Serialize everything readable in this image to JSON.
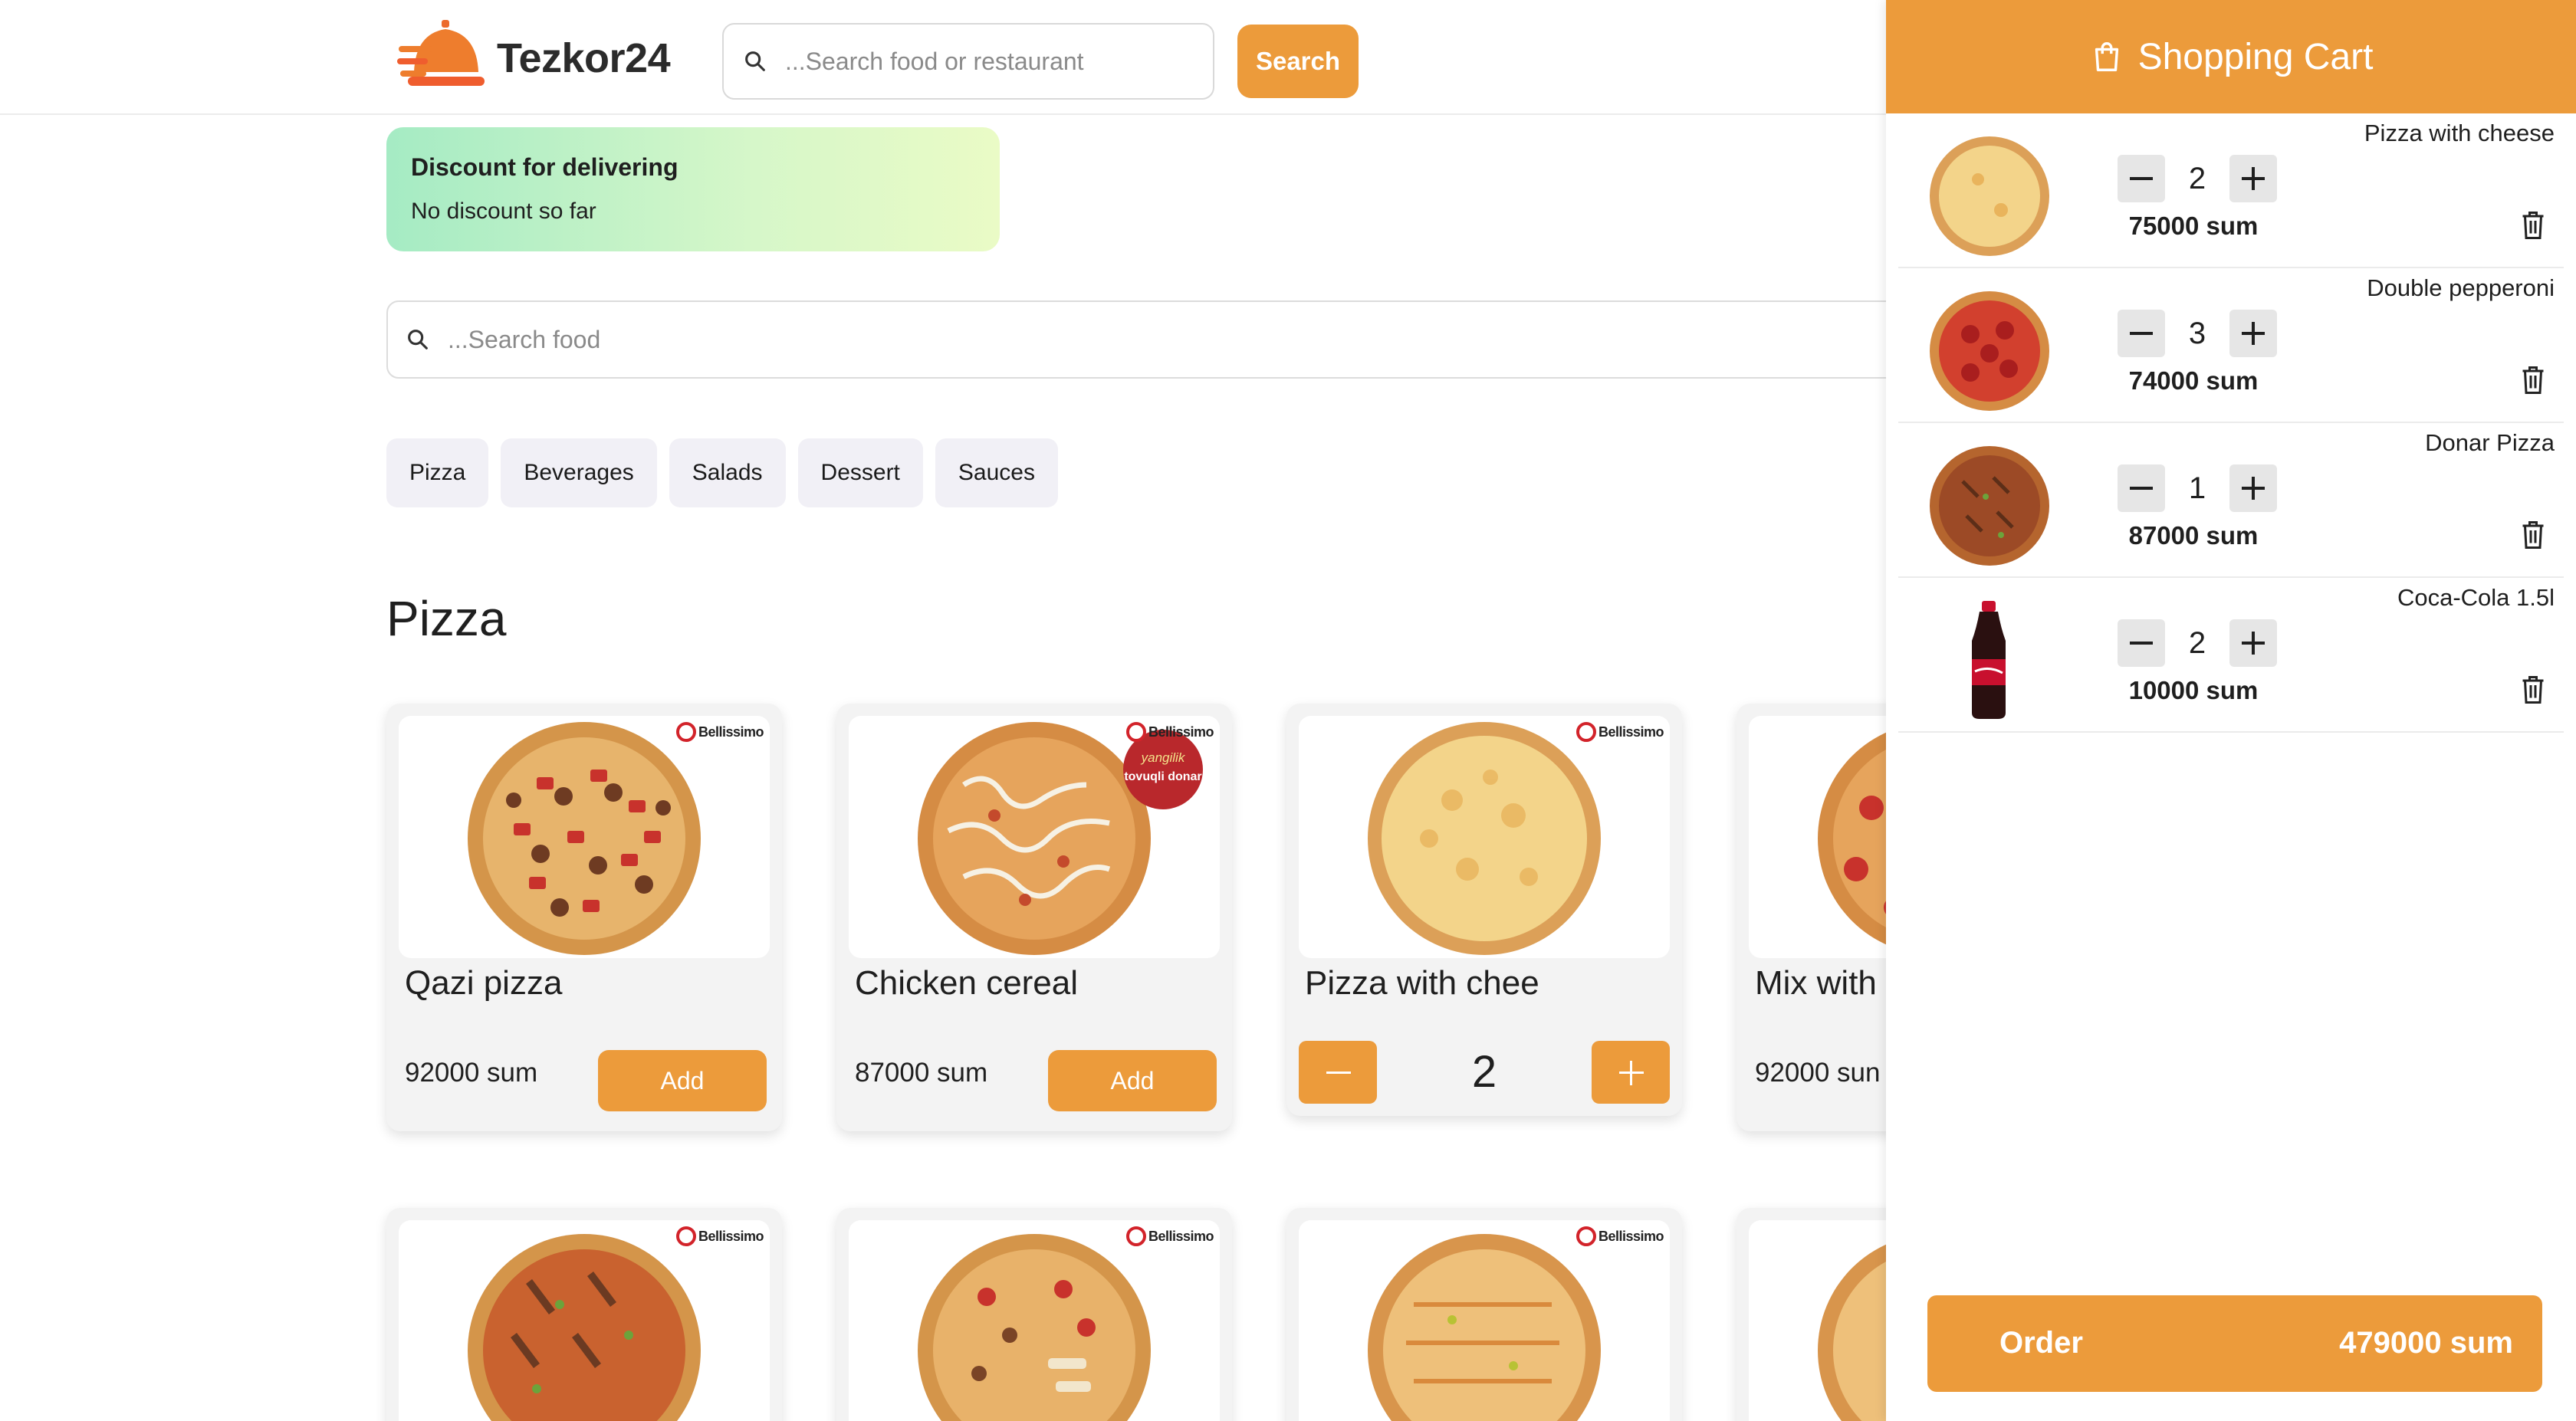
{
  "header": {
    "logo_text": "Tezkor24",
    "search_placeholder": "...Search food or restaurant",
    "search_button": "Search"
  },
  "discount": {
    "title": "Discount for delivering",
    "text": "No discount so far"
  },
  "food_search": {
    "placeholder": "...Search food"
  },
  "categories": [
    "Pizza",
    "Beverages",
    "Salads",
    "Dessert",
    "Sauces"
  ],
  "section_title": "Pizza",
  "brand": "Bellissimo",
  "products": [
    {
      "name": "Qazi pizza",
      "price": "92000 sum",
      "button": "Add"
    },
    {
      "name": "Chicken cereal",
      "price": "87000 sum",
      "button": "Add",
      "badge_line1": "yangilik",
      "badge_line2": "tovuqli donar"
    },
    {
      "name": "Pizza with chee",
      "quantity": "2"
    },
    {
      "name": "Mix with",
      "price": "92000 sun"
    }
  ],
  "cart": {
    "title": "Shopping Cart",
    "items": [
      {
        "name": "Pizza with cheese",
        "quantity": "2",
        "price": "75000 sum"
      },
      {
        "name": "Double pepperoni",
        "quantity": "3",
        "price": "74000 sum"
      },
      {
        "name": "Donar Pizza",
        "quantity": "1",
        "price": "87000 sum"
      },
      {
        "name": "Coca-Cola 1.5l",
        "quantity": "2",
        "price": "10000 sum"
      }
    ],
    "order_label": "Order",
    "order_total": "479000 sum"
  },
  "colors": {
    "accent": "#ec9b3b",
    "category_bg": "#f1f0f6",
    "discount_gradient_start": "#a5ebc4",
    "discount_gradient_end": "#eafbc6"
  }
}
